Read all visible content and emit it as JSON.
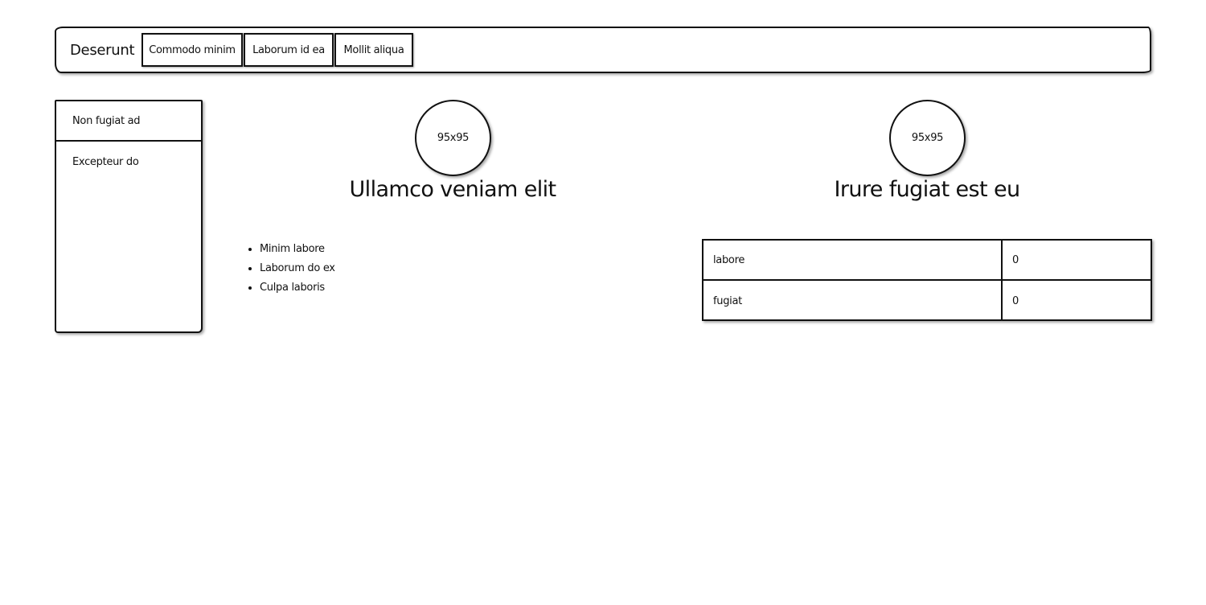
{
  "navbar": {
    "brand": "Deserunt",
    "tabs": [
      {
        "label": "Commodo minim"
      },
      {
        "label": "Laborum id ea"
      },
      {
        "label": "Mollit aliqua"
      }
    ]
  },
  "sidebar": {
    "items": [
      {
        "label": "Non fugiat ad"
      },
      {
        "label": "Excepteur do"
      }
    ]
  },
  "left_panel": {
    "avatar_text": "95x95",
    "heading": "Ullamco veniam elit",
    "list": [
      "Minim labore",
      "Laborum do ex",
      "Culpa laboris"
    ]
  },
  "right_panel": {
    "avatar_text": "95x95",
    "heading": "Irure fugiat est eu",
    "table": [
      {
        "name": "labore",
        "value": "0"
      },
      {
        "name": "fugiat",
        "value": "0"
      }
    ]
  }
}
